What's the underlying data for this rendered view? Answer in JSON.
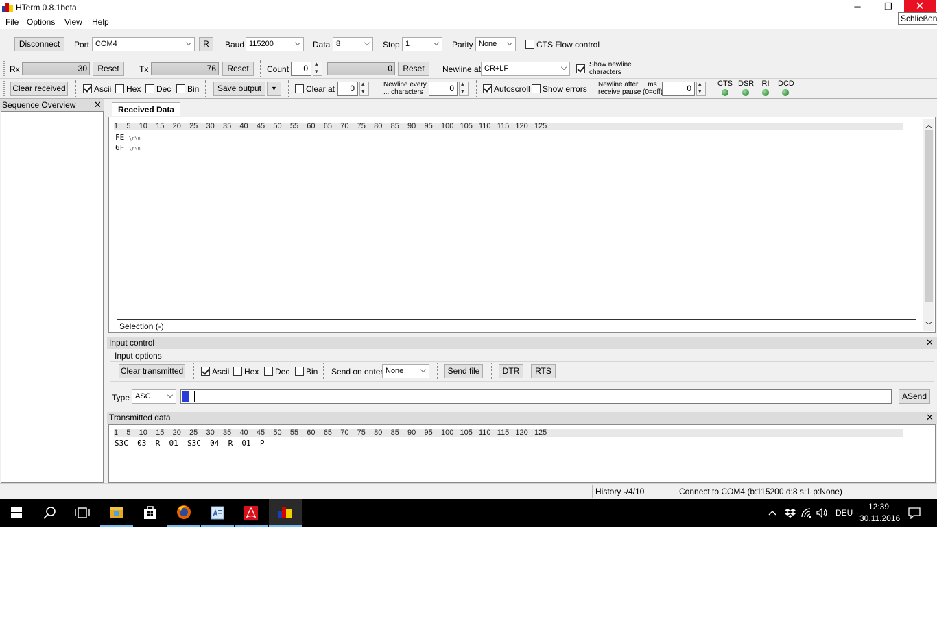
{
  "window": {
    "title": "HTerm 0.8.1beta",
    "close_tooltip": "Schließen",
    "minimize_glyph": "─",
    "restore_glyph": "❐",
    "close_glyph": "✕"
  },
  "menu": [
    "File",
    "Options",
    "View",
    "Help"
  ],
  "connection": {
    "disconnect_label": "Disconnect",
    "port_label": "Port",
    "port_value": "COM4",
    "r_label": "R",
    "baud_label": "Baud",
    "baud_value": "115200",
    "data_label": "Data",
    "data_value": "8",
    "stop_label": "Stop",
    "stop_value": "1",
    "parity_label": "Parity",
    "parity_value": "None",
    "cts_label": "CTS Flow control",
    "cts_checked": false
  },
  "counters": {
    "rx_label": "Rx",
    "rx_value": "30",
    "rx_reset": "Reset",
    "tx_label": "Tx",
    "tx_value": "76",
    "tx_reset": "Reset",
    "count_label": "Count",
    "count_value": "0",
    "count_gauge": "0",
    "count_reset": "Reset",
    "newline_label": "Newline at",
    "newline_value": "CR+LF",
    "show_newline_line1": "Show newline",
    "show_newline_line2": "characters",
    "show_newline_checked": true
  },
  "received_options": {
    "clear_received": "Clear received",
    "ascii": "Ascii",
    "hex": "Hex",
    "dec": "Dec",
    "bin": "Bin",
    "save_output": "Save output",
    "clear_at": "Clear at",
    "clear_at_value": "0",
    "newline_every_1": "Newline every",
    "newline_every_2": "... characters",
    "newline_every_value": "0",
    "autoscroll": "Autoscroll",
    "show_errors": "Show errors",
    "newline_after_1": "Newline after ... ms",
    "newline_after_2": "receive pause (0=off)",
    "newline_after_value": "0",
    "leds": [
      "CTS",
      "DSR",
      "RI",
      "DCD"
    ]
  },
  "sequence_overview": {
    "title": "Sequence Overview"
  },
  "received": {
    "tab": "Received Data",
    "ruler": "1    5    10    15    20    25    30    35    40    45    50    55    60    65    70    75    80    85    90    95    100   105   110   115   120   125",
    "lines": [
      {
        "text": "FE",
        "suffix": "\\r\\n"
      },
      {
        "text": "6F",
        "suffix": "\\r\\n"
      }
    ],
    "selection": "Selection (-)"
  },
  "input_control": {
    "title": "Input control",
    "options_title": "Input options",
    "clear_transmitted": "Clear transmitted",
    "ascii": "Ascii",
    "hex": "Hex",
    "dec": "Dec",
    "bin": "Bin",
    "send_on_enter_label": "Send on enter",
    "send_on_enter_value": "None",
    "send_file": "Send file",
    "dtr": "DTR",
    "rts": "RTS",
    "type_label": "Type",
    "type_value": "ASC",
    "asend": "ASend"
  },
  "transmitted": {
    "title": "Transmitted data",
    "ruler": "1    5    10    15    20    25    30    35    40    45    50    55    60    65    70    75    80    85    90    95    100   105   110   115   120   125",
    "line": "S3C  03  R  01  S3C  04  R  01  P"
  },
  "status": {
    "history": "History -/4/10",
    "connection": "Connect to COM4 (b:115200 d:8 s:1 p:None)"
  },
  "taskbar": {
    "language": "DEU",
    "time": "12:39",
    "date": "30.11.2016"
  }
}
